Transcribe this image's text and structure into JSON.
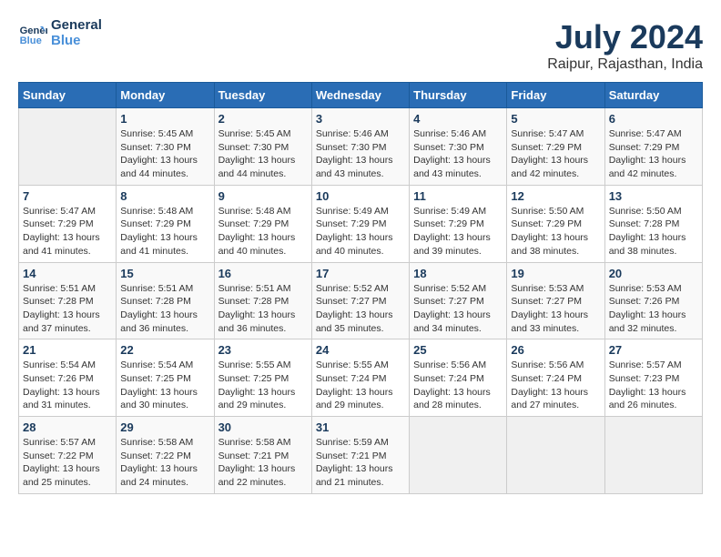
{
  "header": {
    "logo_line1": "General",
    "logo_line2": "Blue",
    "title": "July 2024",
    "subtitle": "Raipur, Rajasthan, India"
  },
  "weekdays": [
    "Sunday",
    "Monday",
    "Tuesday",
    "Wednesday",
    "Thursday",
    "Friday",
    "Saturday"
  ],
  "weeks": [
    [
      {
        "day": "",
        "empty": true
      },
      {
        "day": "1",
        "sunrise": "5:45 AM",
        "sunset": "7:30 PM",
        "daylight": "13 hours and 44 minutes."
      },
      {
        "day": "2",
        "sunrise": "5:45 AM",
        "sunset": "7:30 PM",
        "daylight": "13 hours and 44 minutes."
      },
      {
        "day": "3",
        "sunrise": "5:46 AM",
        "sunset": "7:30 PM",
        "daylight": "13 hours and 43 minutes."
      },
      {
        "day": "4",
        "sunrise": "5:46 AM",
        "sunset": "7:30 PM",
        "daylight": "13 hours and 43 minutes."
      },
      {
        "day": "5",
        "sunrise": "5:47 AM",
        "sunset": "7:29 PM",
        "daylight": "13 hours and 42 minutes."
      },
      {
        "day": "6",
        "sunrise": "5:47 AM",
        "sunset": "7:29 PM",
        "daylight": "13 hours and 42 minutes."
      }
    ],
    [
      {
        "day": "7",
        "sunrise": "5:47 AM",
        "sunset": "7:29 PM",
        "daylight": "13 hours and 41 minutes."
      },
      {
        "day": "8",
        "sunrise": "5:48 AM",
        "sunset": "7:29 PM",
        "daylight": "13 hours and 41 minutes."
      },
      {
        "day": "9",
        "sunrise": "5:48 AM",
        "sunset": "7:29 PM",
        "daylight": "13 hours and 40 minutes."
      },
      {
        "day": "10",
        "sunrise": "5:49 AM",
        "sunset": "7:29 PM",
        "daylight": "13 hours and 40 minutes."
      },
      {
        "day": "11",
        "sunrise": "5:49 AM",
        "sunset": "7:29 PM",
        "daylight": "13 hours and 39 minutes."
      },
      {
        "day": "12",
        "sunrise": "5:50 AM",
        "sunset": "7:29 PM",
        "daylight": "13 hours and 38 minutes."
      },
      {
        "day": "13",
        "sunrise": "5:50 AM",
        "sunset": "7:28 PM",
        "daylight": "13 hours and 38 minutes."
      }
    ],
    [
      {
        "day": "14",
        "sunrise": "5:51 AM",
        "sunset": "7:28 PM",
        "daylight": "13 hours and 37 minutes."
      },
      {
        "day": "15",
        "sunrise": "5:51 AM",
        "sunset": "7:28 PM",
        "daylight": "13 hours and 36 minutes."
      },
      {
        "day": "16",
        "sunrise": "5:51 AM",
        "sunset": "7:28 PM",
        "daylight": "13 hours and 36 minutes."
      },
      {
        "day": "17",
        "sunrise": "5:52 AM",
        "sunset": "7:27 PM",
        "daylight": "13 hours and 35 minutes."
      },
      {
        "day": "18",
        "sunrise": "5:52 AM",
        "sunset": "7:27 PM",
        "daylight": "13 hours and 34 minutes."
      },
      {
        "day": "19",
        "sunrise": "5:53 AM",
        "sunset": "7:27 PM",
        "daylight": "13 hours and 33 minutes."
      },
      {
        "day": "20",
        "sunrise": "5:53 AM",
        "sunset": "7:26 PM",
        "daylight": "13 hours and 32 minutes."
      }
    ],
    [
      {
        "day": "21",
        "sunrise": "5:54 AM",
        "sunset": "7:26 PM",
        "daylight": "13 hours and 31 minutes."
      },
      {
        "day": "22",
        "sunrise": "5:54 AM",
        "sunset": "7:25 PM",
        "daylight": "13 hours and 30 minutes."
      },
      {
        "day": "23",
        "sunrise": "5:55 AM",
        "sunset": "7:25 PM",
        "daylight": "13 hours and 29 minutes."
      },
      {
        "day": "24",
        "sunrise": "5:55 AM",
        "sunset": "7:24 PM",
        "daylight": "13 hours and 29 minutes."
      },
      {
        "day": "25",
        "sunrise": "5:56 AM",
        "sunset": "7:24 PM",
        "daylight": "13 hours and 28 minutes."
      },
      {
        "day": "26",
        "sunrise": "5:56 AM",
        "sunset": "7:24 PM",
        "daylight": "13 hours and 27 minutes."
      },
      {
        "day": "27",
        "sunrise": "5:57 AM",
        "sunset": "7:23 PM",
        "daylight": "13 hours and 26 minutes."
      }
    ],
    [
      {
        "day": "28",
        "sunrise": "5:57 AM",
        "sunset": "7:22 PM",
        "daylight": "13 hours and 25 minutes."
      },
      {
        "day": "29",
        "sunrise": "5:58 AM",
        "sunset": "7:22 PM",
        "daylight": "13 hours and 24 minutes."
      },
      {
        "day": "30",
        "sunrise": "5:58 AM",
        "sunset": "7:21 PM",
        "daylight": "13 hours and 22 minutes."
      },
      {
        "day": "31",
        "sunrise": "5:59 AM",
        "sunset": "7:21 PM",
        "daylight": "13 hours and 21 minutes."
      },
      {
        "day": "",
        "empty": true
      },
      {
        "day": "",
        "empty": true
      },
      {
        "day": "",
        "empty": true
      }
    ]
  ],
  "labels": {
    "sunrise_prefix": "Sunrise: ",
    "sunset_prefix": "Sunset: ",
    "daylight_label": "Daylight: "
  }
}
